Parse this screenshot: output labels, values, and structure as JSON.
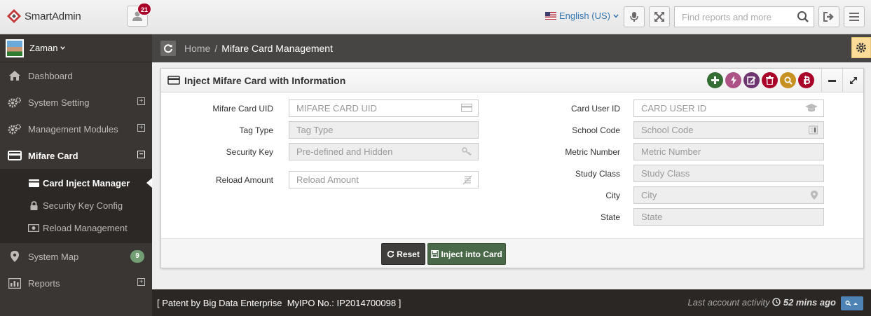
{
  "header": {
    "app_name": "SmartAdmin",
    "notification_count": "21",
    "language": "English (US)",
    "search_placeholder": "Find reports and more"
  },
  "user": {
    "name": "Zaman"
  },
  "sidebar": {
    "items": [
      {
        "label": "Dashboard",
        "icon": "home-icon"
      },
      {
        "label": "System Setting",
        "icon": "gears-icon"
      },
      {
        "label": "Management Modules",
        "icon": "gears-icon"
      },
      {
        "label": "Mifare Card",
        "icon": "credit-card-icon"
      },
      {
        "label": "System Map",
        "icon": "map-marker-icon",
        "badge": "9"
      },
      {
        "label": "Reports",
        "icon": "bar-chart-icon"
      }
    ],
    "subitems": [
      {
        "label": "Card Inject Manager",
        "icon": "credit-card-icon"
      },
      {
        "label": "Security Key Config",
        "icon": "lock-icon"
      },
      {
        "label": "Reload Management",
        "icon": "money-icon"
      }
    ]
  },
  "breadcrumb": {
    "home": "Home",
    "separator": "/",
    "current": "Mifare Card Management"
  },
  "widget": {
    "title": "Inject Mifare Card with Information",
    "tool_colors": [
      "#356e35",
      "#ac5287",
      "#6e3671",
      "#a90329",
      "#c79121",
      "#a90329"
    ]
  },
  "form": {
    "left": [
      {
        "label": "Mifare Card UID",
        "placeholder": "MIFARE CARD UID",
        "disabled": false
      },
      {
        "label": "Tag Type",
        "placeholder": "Tag Type",
        "disabled": true
      },
      {
        "label": "Security Key",
        "placeholder": "Pre-defined and Hidden",
        "disabled": true
      },
      {
        "label": "Reload Amount",
        "placeholder": "Reload Amount",
        "disabled": false
      }
    ],
    "right": [
      {
        "label": "Card User ID",
        "placeholder": "CARD USER ID",
        "disabled": false
      },
      {
        "label": "School Code",
        "placeholder": "School Code",
        "disabled": true
      },
      {
        "label": "Metric Number",
        "placeholder": "Metric Number",
        "disabled": true
      },
      {
        "label": "Study Class",
        "placeholder": "Study Class",
        "disabled": true
      },
      {
        "label": "City",
        "placeholder": "City",
        "disabled": true
      },
      {
        "label": "State",
        "placeholder": "State",
        "disabled": true
      }
    ]
  },
  "buttons": {
    "reset": "Reset",
    "inject": "Inject into Card"
  },
  "footer": {
    "patent": "[ Patent by Big Data Enterprise  MyIPO No.: IP2014700098 ]",
    "activity_label": "Last account activity",
    "activity_time": "52 mins ago"
  }
}
